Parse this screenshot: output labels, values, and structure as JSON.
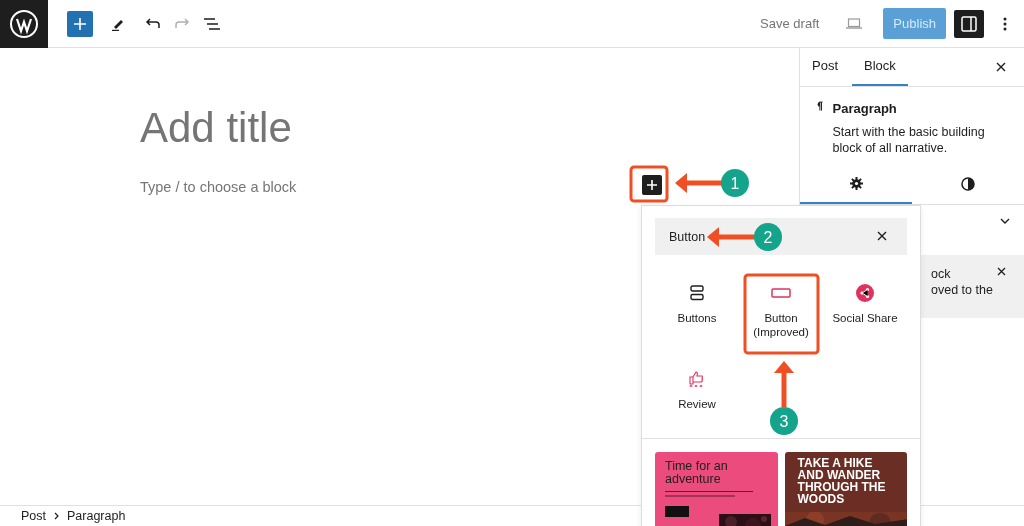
{
  "top_bar": {
    "save_draft": "Save draft",
    "publish": {
      "label": "Publish",
      "disabled": true
    },
    "settings_toggle": {
      "pressed": true
    }
  },
  "editor": {
    "title_placeholder": "Add title",
    "block_placeholder": "Type / to choose a block"
  },
  "sidebar": {
    "tabs": [
      {
        "label": "Post",
        "selected": false
      },
      {
        "label": "Block",
        "selected": true
      }
    ],
    "block_card": {
      "title": "Paragraph",
      "description": "Start with the basic building block of all narrative."
    },
    "subtabs": [
      {
        "kind": "settings",
        "selected": true
      },
      {
        "kind": "styles",
        "selected": false
      }
    ],
    "notice": {
      "lines": [
        "ock",
        "oved to the"
      ]
    }
  },
  "inserter": {
    "search": {
      "value": "Button"
    },
    "blocks": [
      {
        "label": "Buttons",
        "kind": "buttons"
      },
      {
        "label": "Button (Improved)",
        "kind": "button"
      },
      {
        "label": "Social Share",
        "kind": "share"
      },
      {
        "label": "Review",
        "kind": "review"
      }
    ],
    "patterns": [
      {
        "kind": "adventure",
        "heading": "Time for an adventure"
      },
      {
        "kind": "hike",
        "heading": "TAKE A HIKE AND WANDER THROUGH THE WOODS"
      }
    ]
  },
  "annotations": [
    {
      "number": "1"
    },
    {
      "number": "2"
    },
    {
      "number": "3"
    }
  ],
  "breadcrumb": [
    "Post",
    "Paragraph"
  ]
}
